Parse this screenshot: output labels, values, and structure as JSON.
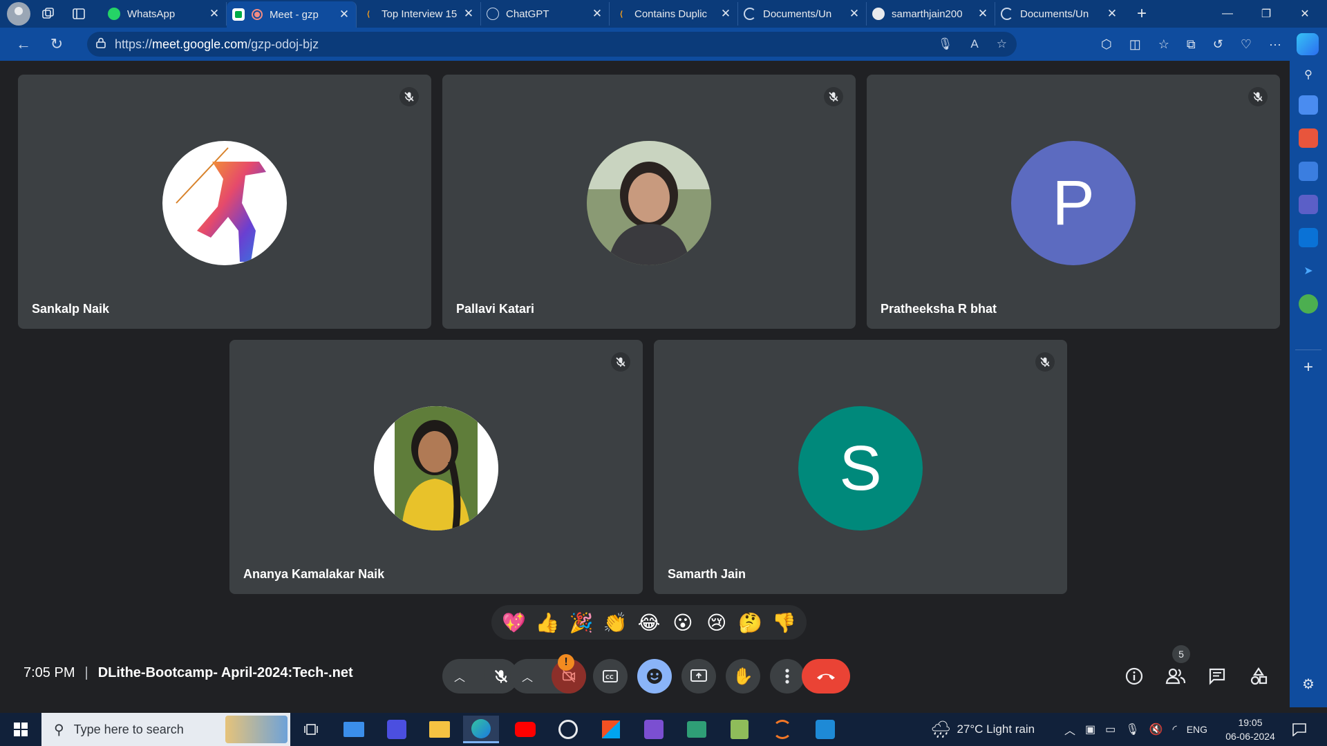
{
  "browser": {
    "tabs": [
      {
        "title": "WhatsApp",
        "favicon": "whatsapp-icon",
        "active": false
      },
      {
        "title": "Meet - gzp",
        "favicon": "meet-icon",
        "active": true
      },
      {
        "title": "Top Interview 15",
        "favicon": "leetcode-icon",
        "active": false
      },
      {
        "title": "ChatGPT",
        "favicon": "chatgpt-icon",
        "active": false
      },
      {
        "title": "Contains Duplic",
        "favicon": "leetcode-icon",
        "active": false
      },
      {
        "title": "Documents/Un",
        "favicon": "loading-icon",
        "active": false
      },
      {
        "title": "samarthjain200",
        "favicon": "github-icon",
        "active": false
      },
      {
        "title": "Documents/Un",
        "favicon": "loading-icon",
        "active": false
      }
    ],
    "url_prefix": "https://",
    "url_host": "meet.google.com",
    "url_path": "/gzp-odoj-bjz"
  },
  "participants": [
    {
      "name": "Sankalp Naik",
      "avatar": "photo-javelin",
      "initial": ""
    },
    {
      "name": "Pallavi Katari",
      "avatar": "photo-person",
      "initial": ""
    },
    {
      "name": "Pratheeksha R bhat",
      "avatar": "initial",
      "initial": "P",
      "color": "#5c6bc0"
    },
    {
      "name": "Ananya Kamalakar Naik",
      "avatar": "photo-person-yellow",
      "initial": ""
    },
    {
      "name": "Samarth Jain",
      "avatar": "initial",
      "initial": "S",
      "color": "#00897b"
    }
  ],
  "reactions": [
    "💖",
    "👍",
    "🎉",
    "👏",
    "😂",
    "😮",
    "😢",
    "🤔",
    "👎"
  ],
  "meeting": {
    "time": "7:05 PM",
    "separator": "|",
    "name": "DLithe-Bootcamp- April-2024:Tech-.net",
    "people_count": "5",
    "camera_alert": "!"
  },
  "taskbar": {
    "search_placeholder": "Type here to search",
    "weather": "27°C  Light rain",
    "language": "ENG",
    "time": "19:05",
    "date": "06-06-2024"
  },
  "colors": {
    "end_call": "#ea4335",
    "mic_off": "#ea4335",
    "reaction_active": "#8ab4f8"
  }
}
